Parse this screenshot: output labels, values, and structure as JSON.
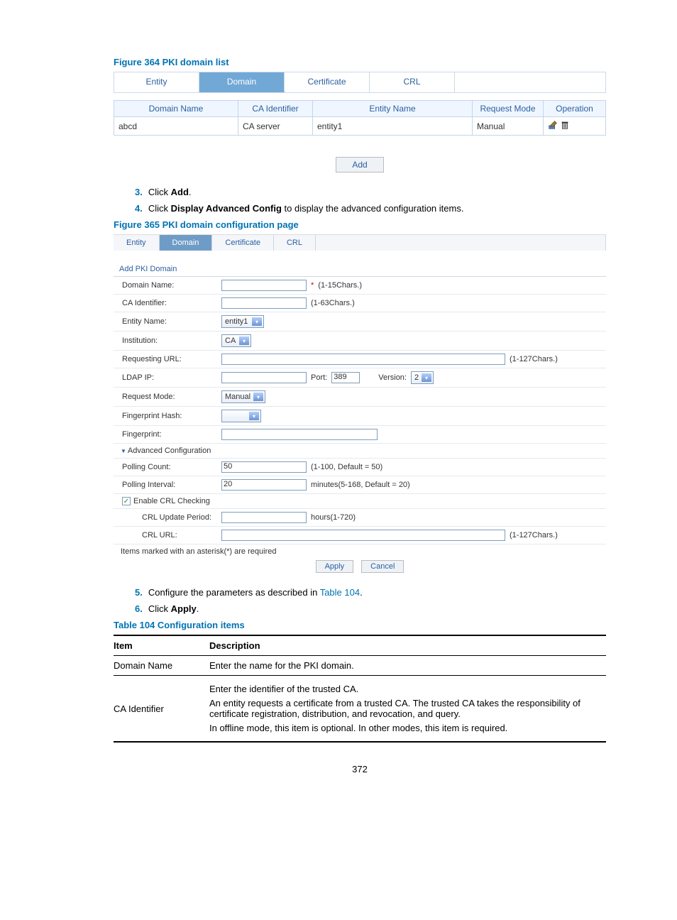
{
  "page_number": "372",
  "fig364": {
    "title": "Figure 364 PKI domain list",
    "tabs": [
      "Entity",
      "Domain",
      "Certificate",
      "CRL"
    ],
    "active_tab": "Domain",
    "headers": [
      "Domain Name",
      "CA Identifier",
      "Entity Name",
      "Request Mode",
      "Operation"
    ],
    "row": {
      "domain": "abcd",
      "ca": "CA server",
      "entity": "entity1",
      "mode": "Manual"
    },
    "add_btn": "Add"
  },
  "steps_a": {
    "s3": {
      "num": "3.",
      "pre": "Click ",
      "bold": "Add",
      "post": "."
    },
    "s4": {
      "num": "4.",
      "pre": "Click ",
      "bold": "Display Advanced Config",
      "post": " to display the advanced configuration items."
    }
  },
  "fig365": {
    "title": "Figure 365 PKI domain configuration page",
    "tabs": [
      "Entity",
      "Domain",
      "Certificate",
      "CRL"
    ],
    "active_tab": "Domain",
    "section": "Add PKI Domain",
    "rows": {
      "domain_name": {
        "lbl": "Domain Name:",
        "note_pre": "* ",
        "note": "(1-15Chars.)"
      },
      "ca_id": {
        "lbl": "CA Identifier:",
        "note": "(1-63Chars.)"
      },
      "entity": {
        "lbl": "Entity Name:",
        "sel": "entity1"
      },
      "inst": {
        "lbl": "Institution:",
        "sel": "CA"
      },
      "req_url": {
        "lbl": "Requesting URL:",
        "note": "(1-127Chars.)"
      },
      "ldap": {
        "lbl": "LDAP IP:",
        "port_lbl": "Port:",
        "port": "389",
        "ver_lbl": "Version:",
        "ver": "2"
      },
      "req_mode": {
        "lbl": "Request Mode:",
        "sel": "Manual"
      },
      "fphash": {
        "lbl": "Fingerprint Hash:",
        "sel": ""
      },
      "fp": {
        "lbl": "Fingerprint:"
      },
      "adv": {
        "lbl": "Advanced Configuration"
      },
      "poll_count": {
        "lbl": "Polling Count:",
        "val": "50",
        "note": "(1-100, Default = 50)"
      },
      "poll_int": {
        "lbl": "Polling Interval:",
        "val": "20",
        "note": "minutes(5-168, Default = 20)"
      },
      "crl_chk": {
        "lbl": "Enable CRL Checking"
      },
      "crl_upd": {
        "lbl": "CRL Update Period:",
        "note": "hours(1-720)"
      },
      "crl_url": {
        "lbl": "CRL URL:",
        "note": "(1-127Chars.)"
      }
    },
    "asterisk_note": "Items marked with an asterisk(*) are required",
    "apply": "Apply",
    "cancel": "Cancel"
  },
  "steps_b": {
    "s5": {
      "num": "5.",
      "pre": "Configure the parameters as described in ",
      "link": "Table 104",
      "post": "."
    },
    "s6": {
      "num": "6.",
      "pre": "Click ",
      "bold": "Apply",
      "post": "."
    }
  },
  "table104": {
    "title": "Table 104 Configuration items",
    "h_item": "Item",
    "h_desc": "Description",
    "r1_item": "Domain Name",
    "r1_desc": "Enter the name for the PKI domain.",
    "r2_item": "CA Identifier",
    "r2_p1": "Enter the identifier of the trusted CA.",
    "r2_p2": "An entity requests a certificate from a trusted CA. The trusted CA takes the responsibility of certificate registration, distribution, and revocation, and query.",
    "r2_p3": "In offline mode, this item is optional. In other modes, this item is required."
  }
}
